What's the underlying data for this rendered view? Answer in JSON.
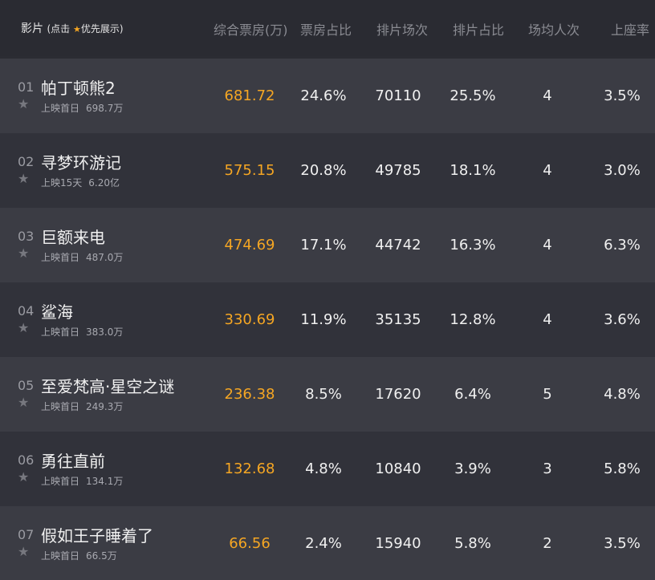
{
  "header": {
    "film": "影片",
    "hint_prefix": "(点击",
    "hint_suffix": "优先展示)",
    "boxoffice": "综合票房(万)",
    "box_ratio": "票房占比",
    "shows": "排片场次",
    "show_ratio": "排片占比",
    "avg_people": "场均人次",
    "occupancy": "上座率"
  },
  "colors": {
    "accent": "#f5a623",
    "row_odd": "#3b3c44",
    "row_even": "#31323a",
    "header_bg": "#2a2b32"
  },
  "rows": [
    {
      "rank": "01",
      "name": "帕丁顿熊2",
      "release": "上映首日",
      "cumulative": "698.7万",
      "boxoffice": "681.72",
      "box_ratio": "24.6%",
      "shows": "70110",
      "show_ratio": "25.5%",
      "avg": "4",
      "occupancy": "3.5%"
    },
    {
      "rank": "02",
      "name": "寻梦环游记",
      "release": "上映15天",
      "cumulative": "6.20亿",
      "boxoffice": "575.15",
      "box_ratio": "20.8%",
      "shows": "49785",
      "show_ratio": "18.1%",
      "avg": "4",
      "occupancy": "3.0%"
    },
    {
      "rank": "03",
      "name": "巨额来电",
      "release": "上映首日",
      "cumulative": "487.0万",
      "boxoffice": "474.69",
      "box_ratio": "17.1%",
      "shows": "44742",
      "show_ratio": "16.3%",
      "avg": "4",
      "occupancy": "6.3%"
    },
    {
      "rank": "04",
      "name": "鲨海",
      "release": "上映首日",
      "cumulative": "383.0万",
      "boxoffice": "330.69",
      "box_ratio": "11.9%",
      "shows": "35135",
      "show_ratio": "12.8%",
      "avg": "4",
      "occupancy": "3.6%"
    },
    {
      "rank": "05",
      "name": "至爱梵高·星空之谜",
      "release": "上映首日",
      "cumulative": "249.3万",
      "boxoffice": "236.38",
      "box_ratio": "8.5%",
      "shows": "17620",
      "show_ratio": "6.4%",
      "avg": "5",
      "occupancy": "4.8%"
    },
    {
      "rank": "06",
      "name": "勇往直前",
      "release": "上映首日",
      "cumulative": "134.1万",
      "boxoffice": "132.68",
      "box_ratio": "4.8%",
      "shows": "10840",
      "show_ratio": "3.9%",
      "avg": "3",
      "occupancy": "5.8%"
    },
    {
      "rank": "07",
      "name": "假如王子睡着了",
      "release": "上映首日",
      "cumulative": "66.5万",
      "boxoffice": "66.56",
      "box_ratio": "2.4%",
      "shows": "15940",
      "show_ratio": "5.8%",
      "avg": "2",
      "occupancy": "3.5%"
    }
  ]
}
